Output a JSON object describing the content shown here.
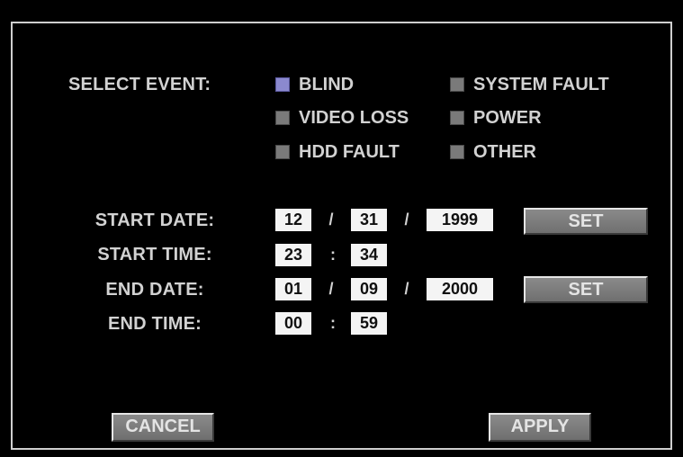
{
  "select_event": {
    "label": "SELECT EVENT:",
    "options": [
      {
        "label": "BLIND",
        "checked": true
      },
      {
        "label": "SYSTEM FAULT",
        "checked": false
      },
      {
        "label": "VIDEO LOSS",
        "checked": false
      },
      {
        "label": "POWER",
        "checked": false
      },
      {
        "label": "HDD FAULT",
        "checked": false
      },
      {
        "label": "OTHER",
        "checked": false
      }
    ]
  },
  "start_date": {
    "label": "START DATE:",
    "month": "12",
    "day": "31",
    "year": "1999",
    "separator": "/"
  },
  "start_time": {
    "label": "START TIME:",
    "hour": "23",
    "minute": "34",
    "separator": ":"
  },
  "end_date": {
    "label": "END DATE:",
    "month": "01",
    "day": "09",
    "year": "2000",
    "separator": "/"
  },
  "end_time": {
    "label": "END TIME:",
    "hour": "00",
    "minute": "59",
    "separator": ":"
  },
  "buttons": {
    "set_start": "SET",
    "set_end": "SET",
    "cancel": "CANCEL",
    "apply": "APPLY"
  },
  "colors": {
    "checked": "#8b89ce",
    "unchecked": "#7a7a7a",
    "field_bg": "#f4f4f4",
    "border": "#cfcfcf"
  }
}
